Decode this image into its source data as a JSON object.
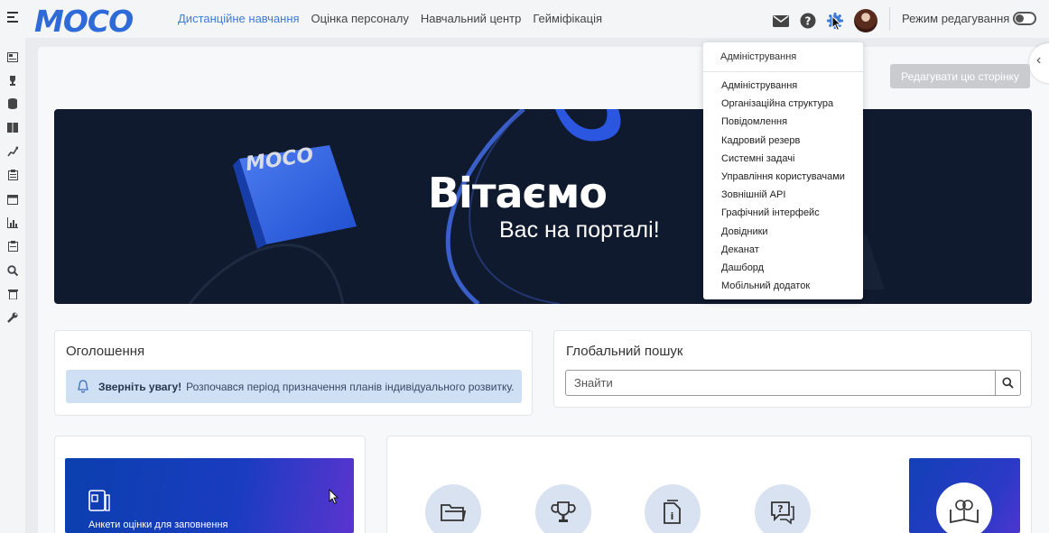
{
  "header": {
    "logo": "MOCO",
    "nav": [
      {
        "label": "Дистанційне навчання",
        "active": true
      },
      {
        "label": "Оцінка персоналу",
        "active": false
      },
      {
        "label": "Навчальний центр",
        "active": false
      },
      {
        "label": "Гейміфікація",
        "active": false
      }
    ],
    "icons": [
      "mail-icon",
      "help-icon",
      "gear-icon",
      "avatar"
    ],
    "edit_mode_label": "Режим редагування",
    "edit_mode_on": false
  },
  "sidebar": {
    "icons": [
      "news-icon",
      "trophy-icon",
      "database-icon",
      "book-icon",
      "chart-line-icon",
      "clipboard-icon",
      "calendar-icon",
      "bar-chart-icon",
      "clipboard-list-icon",
      "search-icon",
      "trash-icon",
      "wrench-icon"
    ]
  },
  "toolbar": {
    "edit_page_label": "Редагувати цю сторінку"
  },
  "banner": {
    "logo_text": "MOCO",
    "title": "Вітаємо",
    "subtitle": "Вас на порталі!"
  },
  "announcements": {
    "title": "Оголошення",
    "alert_strong": "Зверніть увагу!",
    "alert_text": "Розпочався період призначення планів індивідуального розвитку."
  },
  "global_search": {
    "title": "Глобальний пошук",
    "placeholder": "Знайти"
  },
  "tiles": {
    "survey_label": "Анкети оцінки для заповнення"
  },
  "admin_menu": {
    "header": "Адміністрування",
    "items": [
      "Адміністрування",
      "Організаційна структура",
      "Повідомлення",
      "Кадровий резерв",
      "Системні задачі",
      "Управління користувачами",
      "Зовнішній API",
      "Графічний інтерфейс",
      "Довідники",
      "Деканат",
      "Дашборд",
      "Мобільний додаток"
    ]
  },
  "colors": {
    "accent": "#3e7bd6",
    "logo": "#2f6bd8",
    "banner_bg": "#0f1a2e",
    "alert_bg": "#cfe0f5"
  }
}
